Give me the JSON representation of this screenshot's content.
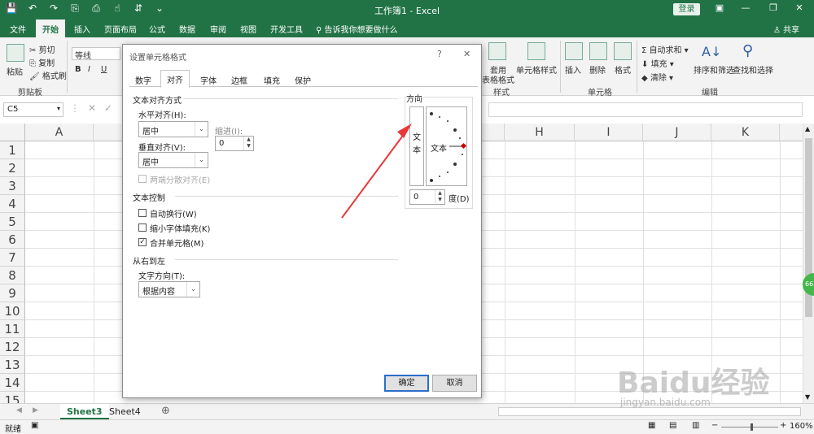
{
  "app": {
    "title": "工作簿1 - Excel",
    "login": "登录",
    "share": "共享",
    "tell_me": "告诉我你想要做什么"
  },
  "ribbon_tabs": [
    "文件",
    "开始",
    "插入",
    "页面布局",
    "公式",
    "数据",
    "审阅",
    "视图",
    "开发工具"
  ],
  "ribbon": {
    "paste": "粘贴",
    "cut": "剪切",
    "copy": "复制",
    "format_painter": "格式刷",
    "clipboard": "剪贴板",
    "font_name": "等线",
    "apply_table_fmt_1": "套用",
    "apply_table_fmt_2": "表格格式",
    "cell_styles": "单元格样式",
    "styles": "样式",
    "insert": "插入",
    "delete": "删除",
    "format": "格式",
    "cells": "单元格",
    "autosum": "自动求和",
    "fill": "填充",
    "clear": "清除",
    "sort_filter": "排序和筛选",
    "find_select": "查找和选择",
    "editing": "编辑"
  },
  "formula_bar": {
    "name_box": "C5"
  },
  "columns": [
    "A",
    "H",
    "I",
    "J",
    "K"
  ],
  "rows": [
    "1",
    "2",
    "3",
    "4",
    "5",
    "6",
    "7",
    "8",
    "9",
    "10",
    "11",
    "12",
    "13",
    "14",
    "15"
  ],
  "sheets": [
    "Sheet3",
    "Sheet4"
  ],
  "status": {
    "ready": "就绪",
    "zoom": "160%"
  },
  "dialog": {
    "title": "设置单元格格式",
    "help": "?",
    "close": "✕",
    "tabs": [
      "数字",
      "对齐",
      "字体",
      "边框",
      "填充",
      "保护"
    ],
    "text_align_section": "文本对齐方式",
    "h_align_label": "水平对齐(H):",
    "h_align_value": "居中",
    "indent_label": "缩进(I):",
    "indent_value": "0",
    "v_align_label": "垂直对齐(V):",
    "v_align_value": "居中",
    "justify_distributed": "两端分散对齐(E)",
    "text_control_section": "文本控制",
    "wrap_text": "自动换行(W)",
    "shrink_fit": "缩小字体填充(K)",
    "merge_cells": "合并单元格(M)",
    "rtl_section": "从右到左",
    "text_direction_label": "文字方向(T):",
    "text_direction_value": "根据内容",
    "orientation_section": "方向",
    "vertical_text": "文本",
    "dial_text": "文本",
    "degrees_value": "0",
    "degrees_label": "度(D)",
    "ok": "确定",
    "cancel": "取消",
    "merge_checked": true
  },
  "watermark": {
    "brand": "Baidu经验",
    "url": "jingyan.baidu.com"
  },
  "colors": {
    "excel_green": "#217346",
    "annotation_red": "#e8383d"
  }
}
